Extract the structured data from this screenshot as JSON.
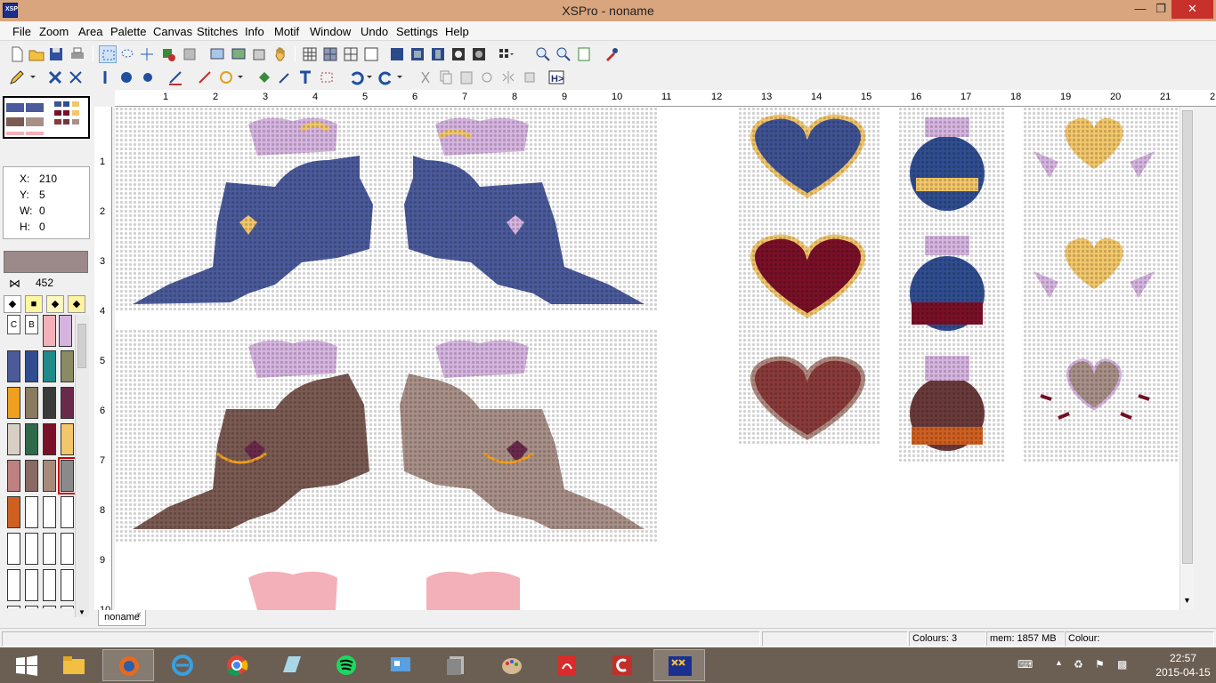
{
  "window": {
    "title": "XSPro - noname",
    "app_icon_label": "XSP"
  },
  "menu": [
    "File",
    "Zoom",
    "Area",
    "Palette",
    "Canvas",
    "Stitches",
    "Info",
    "Motif",
    "Window",
    "Undo",
    "Settings",
    "Help"
  ],
  "coords": {
    "x_label": "X:",
    "x": "210",
    "y_label": "Y:",
    "y": "5",
    "w_label": "W:",
    "w": "0",
    "h_label": "H:",
    "h": "0"
  },
  "colour_number": "452",
  "palette_labels": {
    "c": "C",
    "b": "B"
  },
  "palette_colours": [
    "#eae4dc",
    "#f3b0b8",
    "#d6b4e0",
    "#4a5a9a",
    "#2f4d8f",
    "#1f8a8a",
    "#8a8a64",
    "#f0a020",
    "#8a7a60",
    "#3a3a3a",
    "#6a2a4a",
    "#d8cfc4",
    "#2e6a4a",
    "#7a1028",
    "#f2c66a",
    "#c08080",
    "#8a6a64",
    "#a88a7a",
    "#8a8a8a",
    "#d06020"
  ],
  "ruler": {
    "h_numbers": [
      "1",
      "2",
      "3",
      "4",
      "5",
      "6",
      "7",
      "8",
      "9",
      "10",
      "11",
      "12",
      "13",
      "14",
      "15",
      "16",
      "17",
      "18",
      "19",
      "20",
      "21",
      "2"
    ],
    "v_numbers": [
      "1",
      "2",
      "3",
      "4",
      "5",
      "6",
      "7",
      "8",
      "9",
      "10"
    ]
  },
  "tab": {
    "label": "noname",
    "close": "×"
  },
  "status": {
    "colours": "Colours: 3",
    "mem": "mem: 1857 MB",
    "colour": "Colour:"
  },
  "clock": {
    "time": "22:57",
    "date": "2015-04-15"
  },
  "taskbar_colors": {
    "accent": "#6b5e52"
  },
  "design": {
    "deer_colors": [
      "#4a5a9a",
      "#7a5a52",
      "#a89088"
    ],
    "heart_colors": [
      "#3f5292",
      "#7a1028",
      "#8a3a3a"
    ],
    "ornament_colors": [
      "#2f4d8f",
      "#2f4d8f",
      "#6a3a3a"
    ],
    "gold": "#f2c66a",
    "lilac": "#d6b4e0"
  }
}
